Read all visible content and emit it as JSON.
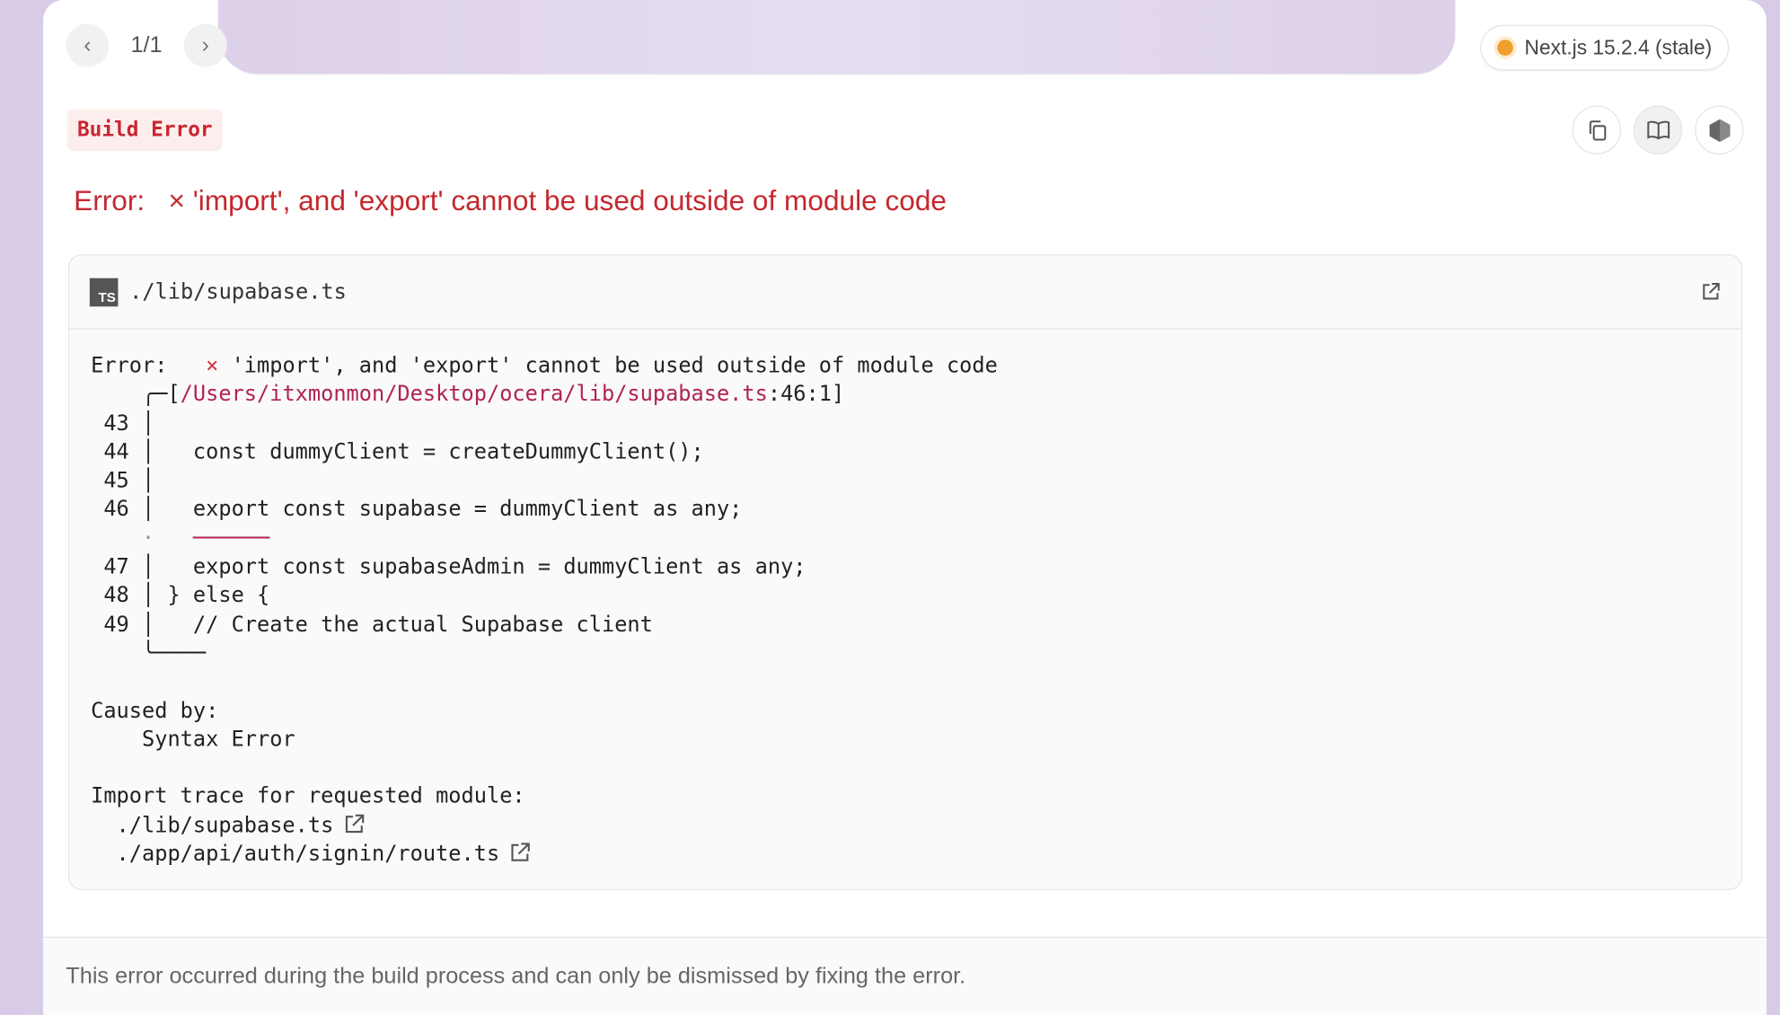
{
  "pager": {
    "label": "1/1"
  },
  "version": {
    "label": "Next.js 15.2.4 (stale)",
    "dot_color": "#f0a030"
  },
  "badge": {
    "label": "Build Error"
  },
  "toolbar": {
    "icons": [
      "copy-icon",
      "docs-book-icon",
      "nextjs-hexagon-icon"
    ]
  },
  "error_title": {
    "prefix": "Error:",
    "mark": "×",
    "message": "'import', and 'export' cannot be used outside of module code"
  },
  "card": {
    "filename": "./lib/supabase.ts",
    "file_type": "TS",
    "error_line": {
      "prefix": "Error:   ",
      "mark": "×",
      "message": " 'import', and 'export' cannot be used outside of module code"
    },
    "location": {
      "open": "    ╭─[",
      "path": "/Users/itxmonmon/Desktop/ocera/lib/supabase.ts",
      "pos": ":46:1]"
    },
    "lines": [
      {
        "n": " 43 │",
        "code": ""
      },
      {
        "n": " 44 │",
        "code": "   const dummyClient = createDummyClient();"
      },
      {
        "n": " 45 │",
        "code": ""
      },
      {
        "n": " 46 │",
        "code": "   export const supabase = dummyClient as any;"
      }
    ],
    "marker": {
      "dot": "    ·",
      "underline": "   ──────"
    },
    "lines2": [
      {
        "n": " 47 │",
        "code": "   export const supabaseAdmin = dummyClient as any;"
      },
      {
        "n": " 48 │",
        "code": " } else {"
      },
      {
        "n": " 49 │",
        "code": "   // Create the actual Supabase client"
      }
    ],
    "close": "    ╰────",
    "caused_by_label": "Caused by:",
    "caused_by": "    Syntax Error",
    "trace_label": "Import trace for requested module:",
    "trace": [
      "  ./lib/supabase.ts",
      "  ./app/api/auth/signin/route.ts"
    ]
  },
  "footer": {
    "text": "This error occurred during the build process and can only be dismissed by fixing the error."
  }
}
